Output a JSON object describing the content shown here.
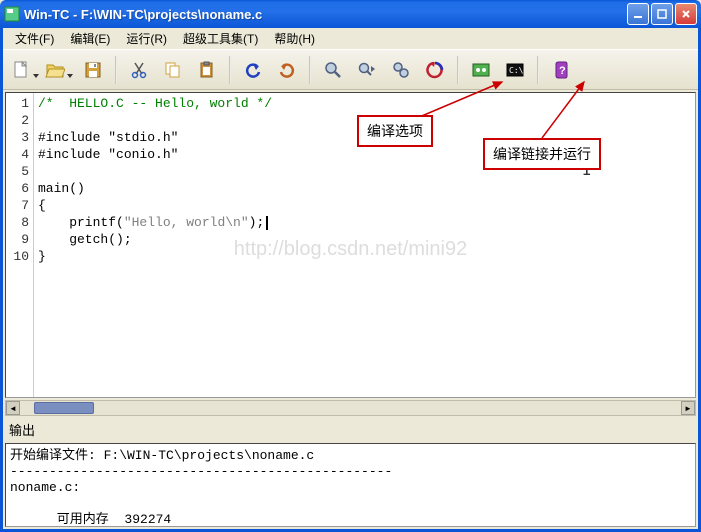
{
  "title": "Win-TC - F:\\WIN-TC\\projects\\noname.c",
  "menu": {
    "file": "文件(F)",
    "edit": "编辑(E)",
    "run": "运行(R)",
    "tools": "超级工具集(T)",
    "help": "帮助(H)"
  },
  "code": {
    "line1": "/*  HELLO.C -- Hello, world */",
    "line3": "#include \"stdio.h\"",
    "line4": "#include \"conio.h\"",
    "line6": "main()",
    "line7": "{",
    "line8a": "    printf(",
    "line8b": "\"Hello, world\\n\"",
    "line8c": ");",
    "line9": "    getch();",
    "line10": "}"
  },
  "gutter": [
    "1",
    "2",
    "3",
    "4",
    "5",
    "6",
    "7",
    "8",
    "9",
    "10"
  ],
  "watermark": "http://blog.csdn.net/mini92",
  "output": {
    "label": "输出",
    "line1": "开始编译文件: F:\\WIN-TC\\projects\\noname.c",
    "line2": "-------------------------------------------------",
    "line3": "noname.c:",
    "line4": "      可用内存  392274"
  },
  "callout1": "编译选项",
  "callout2": "编译链接并运行"
}
